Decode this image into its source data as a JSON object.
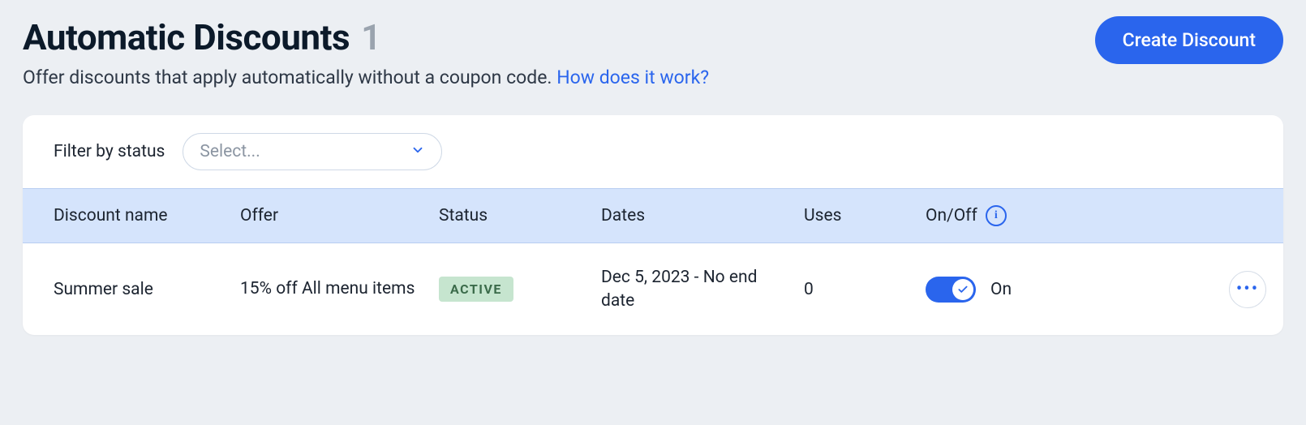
{
  "header": {
    "title": "Automatic Discounts",
    "count": "1",
    "subtitle": "Offer discounts that apply automatically without a coupon code.",
    "help_link": "How does it work?",
    "create_button": "Create Discount"
  },
  "filter": {
    "label": "Filter by status",
    "placeholder": "Select..."
  },
  "table": {
    "columns": {
      "name": "Discount name",
      "offer": "Offer",
      "status": "Status",
      "dates": "Dates",
      "uses": "Uses",
      "onoff": "On/Off"
    },
    "rows": [
      {
        "name": "Summer sale",
        "offer": "15% off All menu items",
        "status": "ACTIVE",
        "dates": "Dec 5, 2023 - No end date",
        "uses": "0",
        "onoff_state": "On"
      }
    ]
  }
}
